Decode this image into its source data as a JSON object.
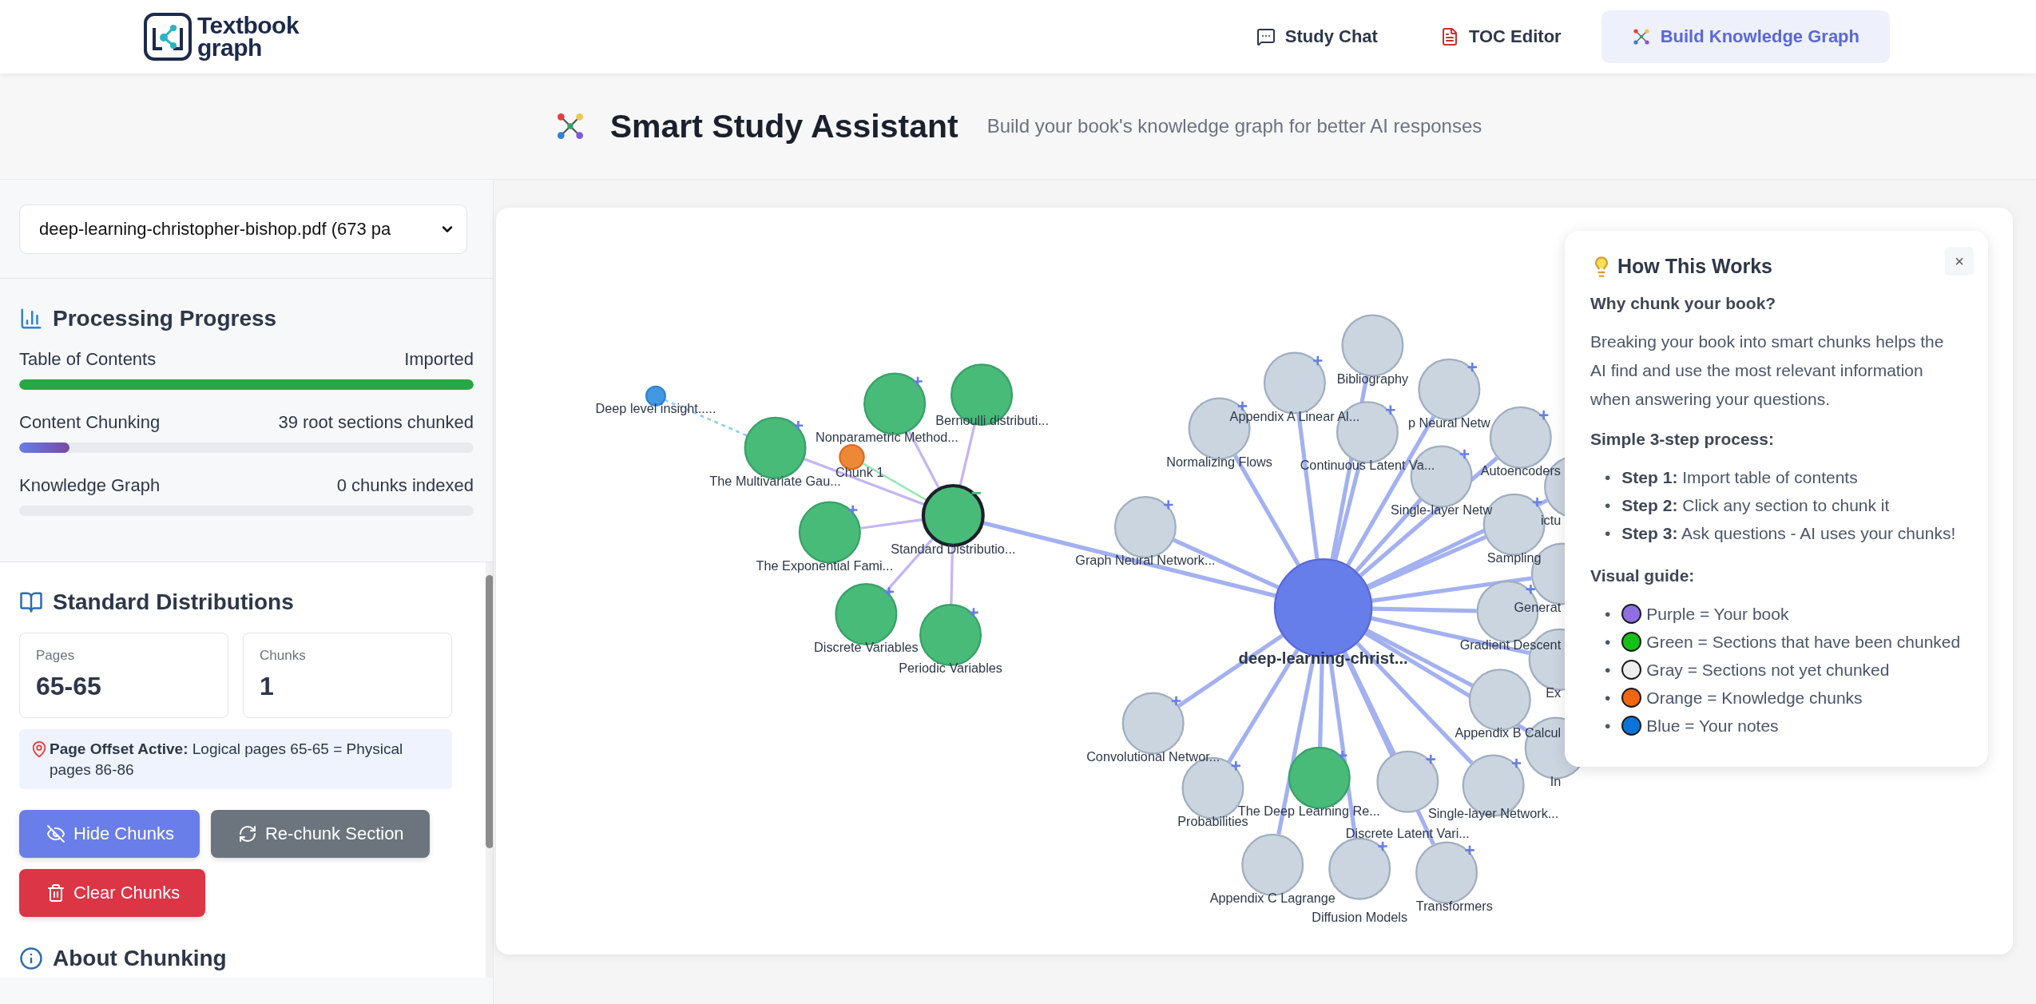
{
  "header": {
    "logo": {
      "line1": "Textbook",
      "line2": "graph"
    },
    "nav": [
      {
        "label": "Study Chat",
        "kind": "chat",
        "selected": false
      },
      {
        "label": "TOC Editor",
        "kind": "toc",
        "selected": false
      },
      {
        "label": "Build Knowledge Graph",
        "kind": "graph",
        "selected": true
      }
    ]
  },
  "title_bar": {
    "title": "Smart Study Assistant",
    "subtitle": "Build your book's knowledge graph for better AI responses"
  },
  "sidebar": {
    "book_select": {
      "value": "deep-learning-christopher-bishop.pdf (673 pa"
    },
    "progress": {
      "title": "Processing Progress",
      "items": [
        {
          "label": "Table of Contents",
          "status": "Imported",
          "level": 1
        },
        {
          "label": "Content Chunking",
          "status": "39 root sections chunked",
          "level": 0.11
        },
        {
          "label": "Knowledge Graph",
          "status": "0 chunks indexed",
          "level": 0
        }
      ]
    },
    "section": {
      "title": "Standard Distributions",
      "stats": [
        {
          "label": "Pages",
          "value": "65-65"
        },
        {
          "label": "Chunks",
          "value": "1"
        }
      ],
      "offset_note": "**Page Offset Active:** Logical pages 65-65 = Physical pages 86-86",
      "buttons": [
        {
          "label": "Hide Chunks",
          "kind": "hide"
        },
        {
          "label": "Re-chunk Section",
          "kind": "rechunk"
        },
        {
          "label": "Clear Chunks",
          "kind": "clear"
        }
      ],
      "next_heading": "About Chunking"
    }
  },
  "graph": {
    "root": {
      "label": "deep-learning-christ...",
      "kind": "book",
      "selected": false,
      "children": [
        {
          "label": "Bibliography",
          "kind": "section",
          "chunked": false,
          "selected": false
        },
        {
          "label": "Appendix A Linear Al...",
          "kind": "section",
          "chunked": false,
          "selected": false,
          "expanded": false
        },
        {
          "label": "p Neural Netw",
          "kind": "section",
          "chunked": false,
          "selected": false,
          "expanded": false
        },
        {
          "label": "Normalizing Flows",
          "kind": "section",
          "chunked": false,
          "selected": false,
          "expanded": false
        },
        {
          "label": "Continuous Latent Va...",
          "kind": "section",
          "chunked": false,
          "selected": false,
          "expanded": false
        },
        {
          "label": "Autoencoders",
          "kind": "section",
          "chunked": false,
          "selected": false,
          "expanded": false
        },
        {
          "label": "Single-layer Netw",
          "kind": "section",
          "chunked": false,
          "selected": false,
          "expanded": false
        },
        {
          "label": "ictu",
          "kind": "section",
          "chunked": false,
          "selected": false
        },
        {
          "label": "Standard Distributio...",
          "kind": "section",
          "chunked": true,
          "selected": true,
          "expanded": true,
          "children": [
            {
              "label": "Bernoulli distributi...",
              "kind": "section",
              "chunked": true,
              "selected": false
            },
            {
              "label": "Nonparametric Method...",
              "kind": "section",
              "chunked": true,
              "selected": false,
              "expanded": false
            },
            {
              "label": "The Multivariate Gau...",
              "kind": "section",
              "chunked": true,
              "selected": false,
              "expanded": false,
              "children": [
                {
                  "label": "Deep level insight.....",
                  "kind": "note",
                  "selected": false
                }
              ]
            },
            {
              "label": "Chunk 1",
              "kind": "chunk",
              "selected": false
            },
            {
              "label": "The Exponential Fami...",
              "kind": "section",
              "chunked": true,
              "selected": false,
              "expanded": false
            },
            {
              "label": "Discrete Variables",
              "kind": "section",
              "chunked": true,
              "selected": false,
              "expanded": false
            },
            {
              "label": "Periodic Variables",
              "kind": "section",
              "chunked": true,
              "selected": false,
              "expanded": false
            }
          ]
        },
        {
          "label": "Graph Neural Network...",
          "kind": "section",
          "chunked": false,
          "selected": false,
          "expanded": false
        },
        {
          "label": "Sampling",
          "kind": "section",
          "chunked": false,
          "selected": false,
          "expanded": false
        },
        {
          "label": "Generat",
          "kind": "section",
          "chunked": false,
          "selected": false
        },
        {
          "label": "Gradient Descent",
          "kind": "section",
          "chunked": false,
          "selected": false,
          "expanded": false
        },
        {
          "label": "Ex",
          "kind": "section",
          "chunked": false,
          "selected": false
        },
        {
          "label": "Appendix B Calcul",
          "kind": "section",
          "chunked": false,
          "selected": false
        },
        {
          "label": "Convolutional Networ...",
          "kind": "section",
          "chunked": false,
          "selected": false,
          "expanded": false
        },
        {
          "label": "In",
          "kind": "section",
          "chunked": false,
          "selected": false
        },
        {
          "label": "Probabilities",
          "kind": "section",
          "chunked": false,
          "selected": false,
          "expanded": false
        },
        {
          "label": "The Deep Learning Re...",
          "kind": "section",
          "chunked": true,
          "selected": false,
          "expanded": false
        },
        {
          "label": "Discrete Latent Vari...",
          "kind": "section",
          "chunked": false,
          "selected": false,
          "expanded": false
        },
        {
          "label": "Single-layer Network...",
          "kind": "section",
          "chunked": false,
          "selected": false,
          "expanded": false
        },
        {
          "label": "Appendix C Lagrange",
          "kind": "section",
          "chunked": false,
          "selected": false
        },
        {
          "label": "Diffusion Models",
          "kind": "section",
          "chunked": false,
          "selected": false,
          "expanded": false
        },
        {
          "label": "Transformers",
          "kind": "section",
          "chunked": false,
          "selected": false,
          "expanded": false
        }
      ]
    }
  },
  "help_panel": {
    "title": "How This Works",
    "close": "×",
    "why_heading": "Why chunk your book?",
    "why_text": "Breaking your book into smart chunks helps the AI find and use the most relevant information when answering your questions.",
    "steps_heading": "Simple 3-step process:",
    "steps": [
      {
        "bullet": "•",
        "text": "**Step 1:** Import table of contents"
      },
      {
        "bullet": "•",
        "text": "**Step 2:** Click any section to chunk it"
      },
      {
        "bullet": "•",
        "text": "**Step 3:** Ask questions - AI uses your chunks!"
      }
    ],
    "guide_heading": "Visual guide:",
    "guide": [
      {
        "bullet": "•",
        "color": "#8f6fe3",
        "text": "Purple = Your book"
      },
      {
        "bullet": "•",
        "color": "#16c016",
        "text": "Green = Sections that have been chunked"
      },
      {
        "bullet": "•",
        "color": "#eeeeee",
        "text": "Gray = Sections not yet chunked"
      },
      {
        "bullet": "•",
        "color": "#f26611",
        "text": "Orange = Knowledge chunks"
      },
      {
        "bullet": "•",
        "color": "#0a74da",
        "text": "Blue = Your notes"
      }
    ]
  }
}
